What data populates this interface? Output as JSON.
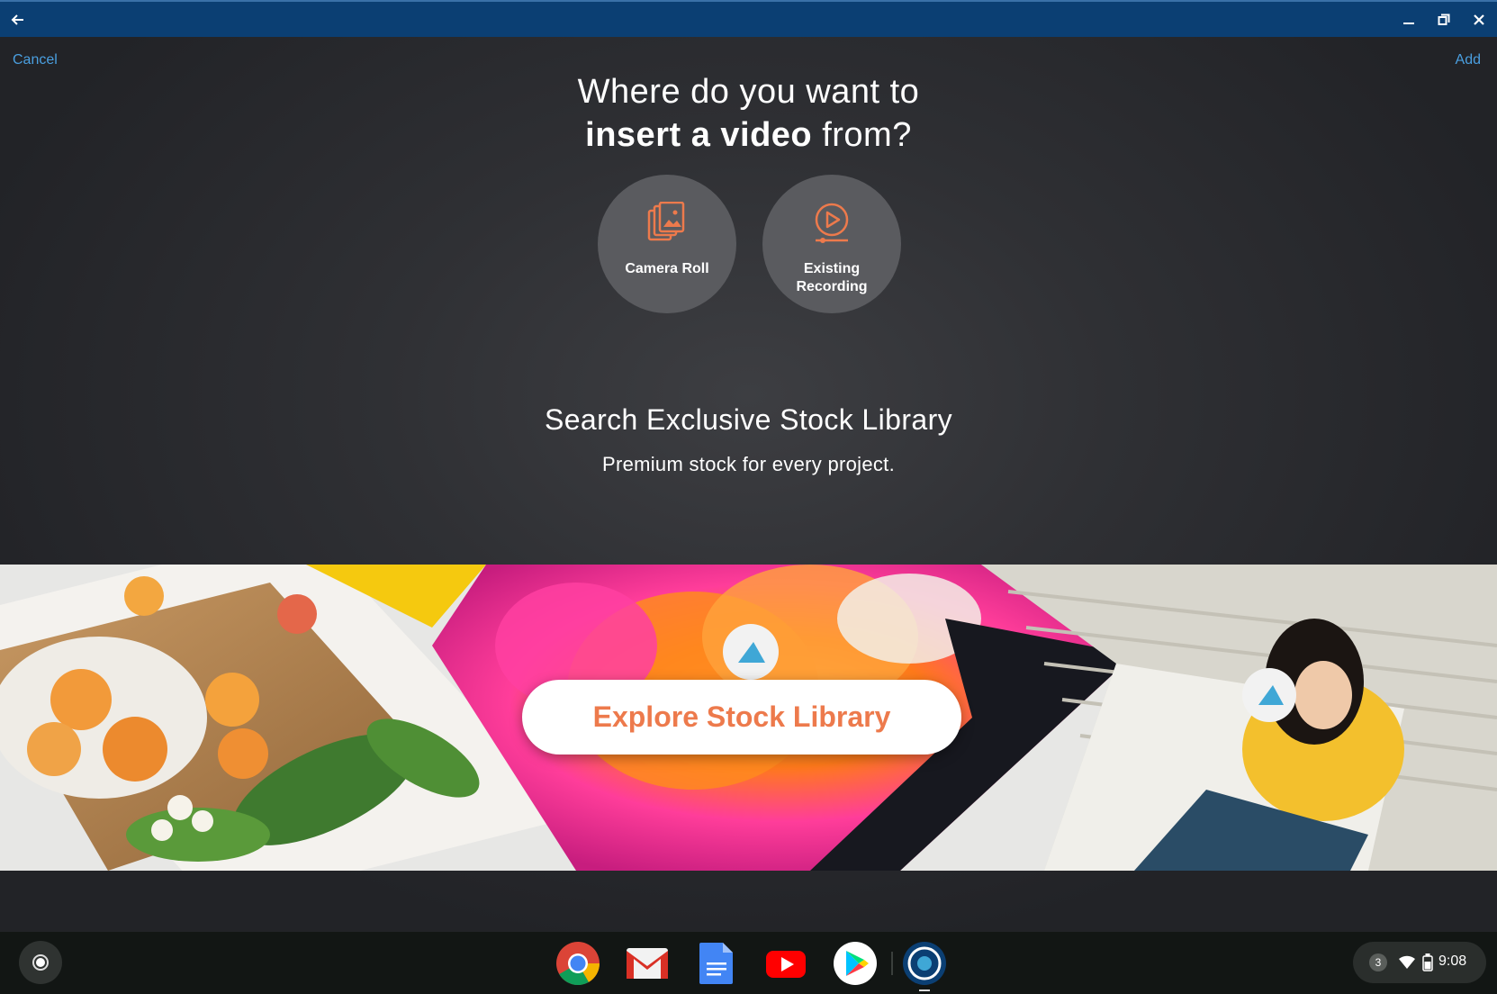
{
  "window": {
    "back_icon": "arrow-left-icon",
    "minimize_icon": "minimize-icon",
    "restore_icon": "restore-icon",
    "close_icon": "close-icon"
  },
  "header": {
    "cancel_label": "Cancel",
    "add_label": "Add"
  },
  "heading": {
    "line1": "Where do you want to",
    "bold": "insert a video",
    "rest": " from?"
  },
  "sources": [
    {
      "label": "Camera Roll",
      "icon": "camera-roll-icon"
    },
    {
      "label_line1": "Existing",
      "label_line2": "Recording",
      "icon": "play-circle-icon"
    }
  ],
  "stock": {
    "title": "Search Exclusive Stock Library",
    "subtitle": "Premium stock for every project.",
    "button_label": "Explore Stock Library"
  },
  "colors": {
    "accent_orange": "#ed7a4c",
    "link_blue": "#4a9fe0",
    "titlebar": "#0b3f73"
  },
  "shelf": {
    "apps": [
      "chrome-icon",
      "gmail-icon",
      "docs-icon",
      "youtube-icon",
      "play-store-icon",
      "active-app-icon"
    ],
    "notification_count": "3",
    "time": "9:08"
  }
}
